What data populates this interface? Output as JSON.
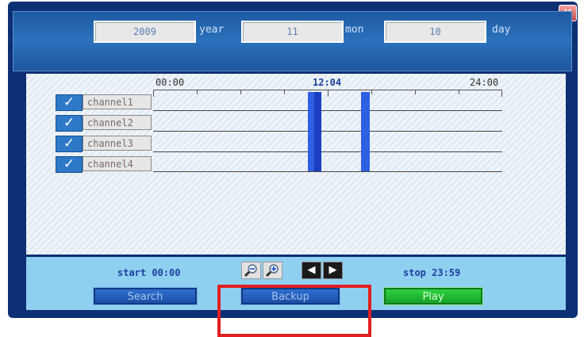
{
  "date": {
    "year_value": "2009",
    "year_unit": "year",
    "month_value": "11",
    "month_unit": "mon",
    "day_value": "10",
    "day_unit": "day"
  },
  "timeline": {
    "start_time": "00:00",
    "current_time": "12:04",
    "end_time": "24:00"
  },
  "channels": [
    {
      "label": "channel1",
      "checked": true
    },
    {
      "label": "channel2",
      "checked": true
    },
    {
      "label": "channel3",
      "checked": true
    },
    {
      "label": "channel4",
      "checked": true
    }
  ],
  "range": {
    "start_label": "start 00:00",
    "stop_label": "stop 23:59"
  },
  "controls": {
    "check_glyph": "✓",
    "close_glyph": "✕",
    "prev_glyph": "◀",
    "next_glyph": "▶"
  },
  "actions": {
    "search_label": "Search",
    "backup_label": "Backup",
    "play_label": "Play"
  },
  "colors": {
    "window_bg": "#0d2f73",
    "recording": "#2f5fe3",
    "highlight": "#e02020",
    "play_button": "#18a42a"
  }
}
